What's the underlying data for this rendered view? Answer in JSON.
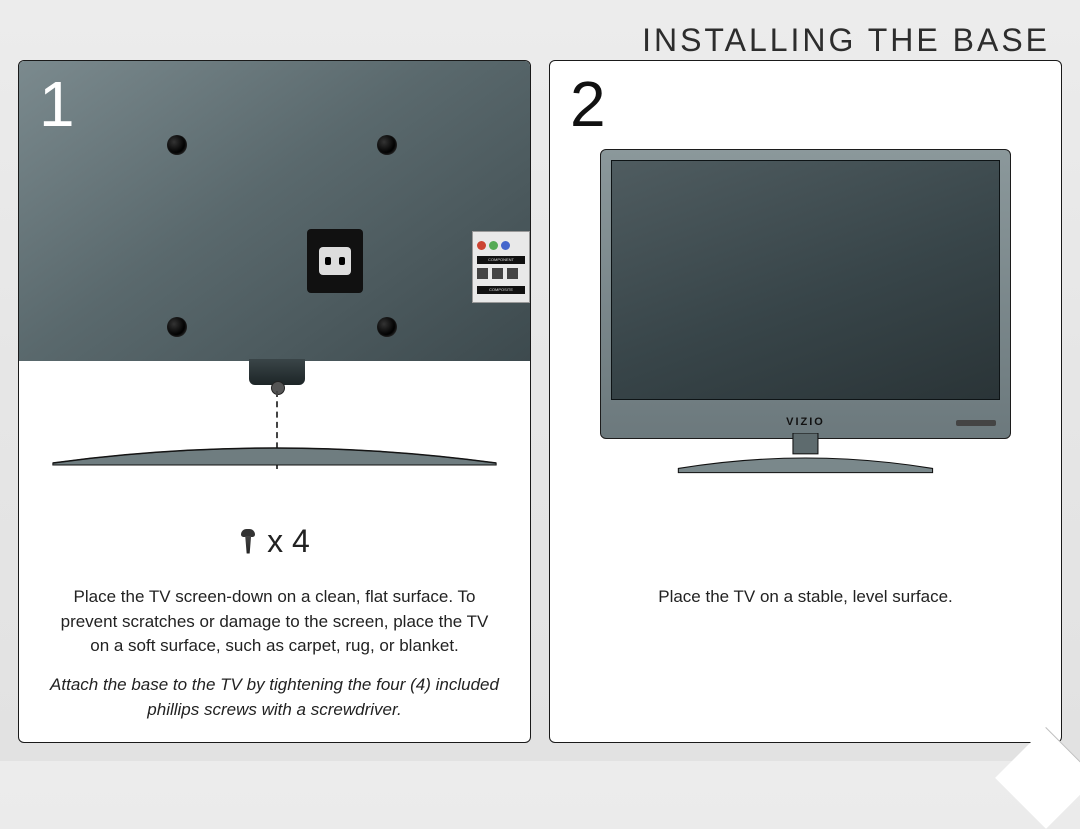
{
  "title": "INSTALLING THE BASE",
  "steps": [
    {
      "number": "1",
      "screw_count_label": "x 4",
      "caption_main": "Place the TV screen-down on a clean, flat surface. To prevent scratches or damage to the screen, place the TV on a soft surface, such as carpet, rug, or blanket.",
      "caption_secondary": "Attach the base to the TV by tightening the four (4) included phillips screws with a screwdriver.",
      "port_labels": {
        "component": "COMPONENT",
        "composite": "COMPOSITE"
      }
    },
    {
      "number": "2",
      "caption_main": "Place the TV on a stable, level surface.",
      "brand_logo": "VIZIO"
    }
  ]
}
